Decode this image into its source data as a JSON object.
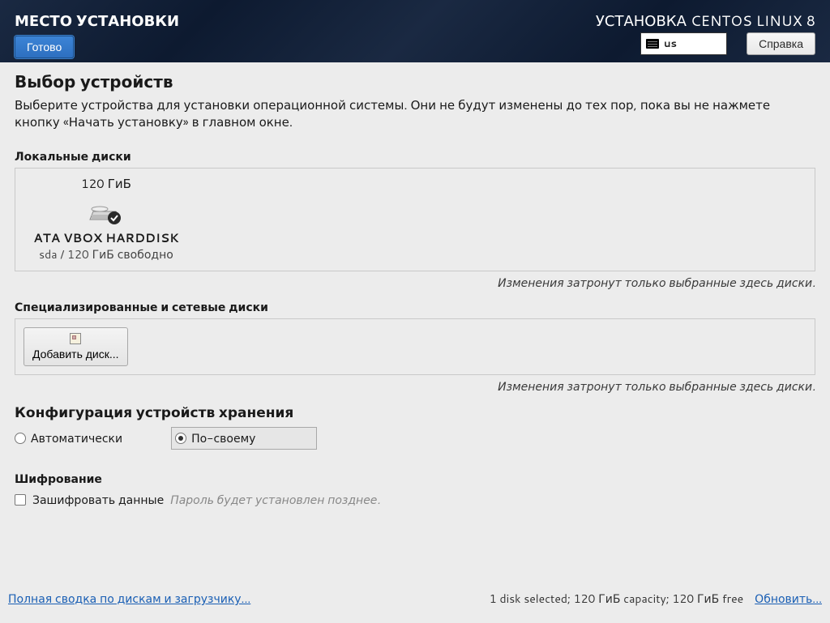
{
  "header": {
    "title_left": "МЕСТО УСТАНОВКИ",
    "title_right": "УСТАНОВКА CENTOS LINUX 8",
    "done_button": "Готово",
    "keyboard_layout": "us",
    "help_button": "Справка"
  },
  "main": {
    "section_title": "Выбор устройств",
    "section_desc": "Выберите устройства для установки операционной системы. Они не будут изменены до тех пор, пока вы не нажмете кнопку «Начать установку» в главном окне.",
    "local_disks_label": "Локальные диски",
    "disk": {
      "size": "120 ГиБ",
      "name": "ATA VBOX HARDDISK",
      "info": "sda  /  120 ГиБ свободно"
    },
    "hint1": "Изменения затронут только выбранные здесь диски.",
    "special_disks_label": "Специализированные и сетевые диски",
    "add_disk_label": "Добавить диск...",
    "hint2": "Изменения затронут только выбранные здесь диски.",
    "config_title": "Конфигурация устройств хранения",
    "radio_auto": "Автоматически",
    "radio_custom": "По-своему",
    "encrypt_title": "Шифрование",
    "encrypt_checkbox": "Зашифровать данные",
    "encrypt_note": "Пароль будет установлен позднее."
  },
  "footer": {
    "summary_link": "Полная сводка по дискам и загрузчику...",
    "status": "1 disk selected; 120 ГиБ capacity; 120 ГиБ free",
    "refresh_link": "Обновить..."
  }
}
